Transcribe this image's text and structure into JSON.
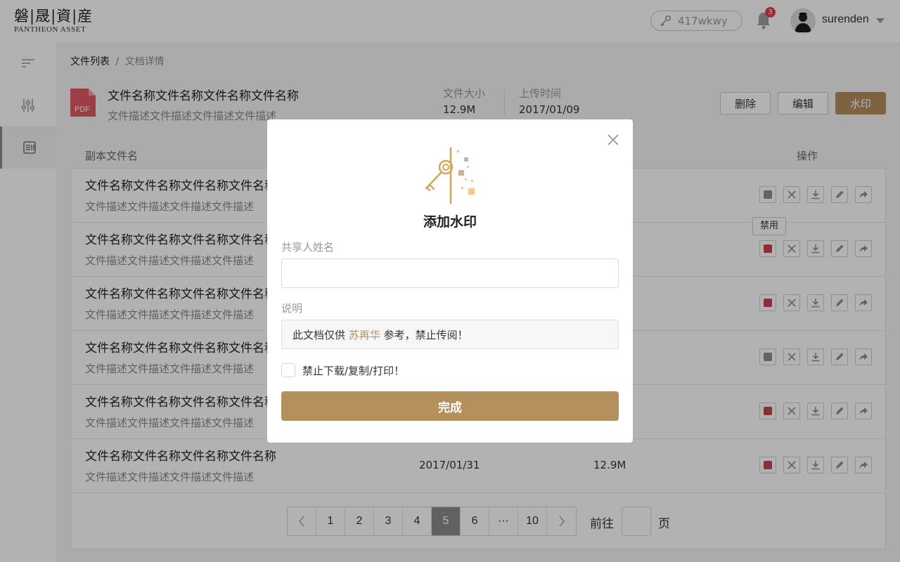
{
  "brand": {
    "name_cn": "磐|晟|資|産",
    "name_en": "PANTHEON ASSET"
  },
  "header": {
    "key_code": "417wkwy",
    "notification_count": "3",
    "username": "surenden"
  },
  "sidebar": {
    "icons": [
      "menu-lines-icon",
      "sliders-icon",
      "document-icon"
    ],
    "active_index": 2
  },
  "breadcrumb": {
    "root": "文件列表",
    "separator": "/",
    "current": "文档详情"
  },
  "document": {
    "badge": "PDF",
    "title": "文件名称文件名称文件名称文件名称",
    "description": "文件描述文件描述文件描述文件描述",
    "size_label": "文件大小",
    "size": "12.9M",
    "upload_label": "上传时间",
    "upload_date": "2017/01/09",
    "buttons": {
      "delete": "删除",
      "edit": "编辑",
      "watermark": "水印"
    }
  },
  "table": {
    "columns": {
      "name": "副本文件名",
      "actions": "操作"
    },
    "rows": [
      {
        "title": "文件名称文件名称文件名称文件名称",
        "desc": "文件描述文件描述文件描述文件描述",
        "date": "",
        "size": "",
        "status": "gray"
      },
      {
        "title": "文件名称文件名称文件名称文件名称",
        "desc": "文件描述文件描述文件描述文件描述",
        "date": "",
        "size": "",
        "status": "red"
      },
      {
        "title": "文件名称文件名称文件名称文件名称",
        "desc": "文件描述文件描述文件描述文件描述",
        "date": "",
        "size": "",
        "status": "red"
      },
      {
        "title": "文件名称文件名称文件名称文件名称",
        "desc": "文件描述文件描述文件描述文件描述",
        "date": "",
        "size": "",
        "status": "gray"
      },
      {
        "title": "文件名称文件名称文件名称文件名称",
        "desc": "文件描述文件描述文件描述文件描述",
        "date": "",
        "size": "",
        "status": "red"
      },
      {
        "title": "文件名称文件名称文件名称文件名称",
        "desc": "文件描述文件描述文件描述文件描述",
        "date": "2017/01/31",
        "size": "12.9M",
        "status": "red"
      }
    ],
    "tooltip": "禁用",
    "action_icons": [
      "disable-icon",
      "close-icon",
      "download-icon",
      "edit-icon",
      "share-icon"
    ]
  },
  "pagination": {
    "prev": "‹",
    "pages": [
      "1",
      "2",
      "3",
      "4",
      "5",
      "6",
      "···",
      "10"
    ],
    "active": "5",
    "next": "›",
    "goto_label": "前往",
    "goto_suffix": "页"
  },
  "modal": {
    "title": "添加水印",
    "sharer_label": "共享人姓名",
    "sharer_value": "",
    "desc_label": "说明",
    "desc_prefix": "此文档仅供 ",
    "desc_name": "苏再华",
    "desc_suffix": " 参考，禁止传阅！",
    "checkbox_label": "禁止下载/复制/打印！",
    "checkbox_checked": false,
    "submit": "完成"
  },
  "colors": {
    "accent": "#b58f5c",
    "danger": "#c8424e",
    "muted": "#8f8f8f"
  }
}
